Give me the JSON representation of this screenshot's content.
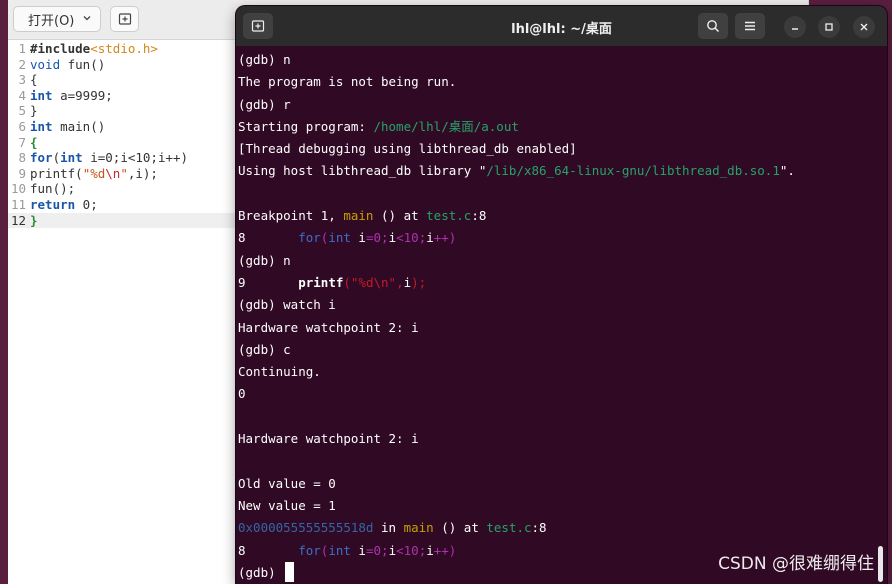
{
  "editor": {
    "open_button_label": "打开(O)",
    "lines": [
      {
        "num": "1"
      },
      {
        "num": "2"
      },
      {
        "num": "3"
      },
      {
        "num": "4"
      },
      {
        "num": "5"
      },
      {
        "num": "6"
      },
      {
        "num": "7"
      },
      {
        "num": "8"
      },
      {
        "num": "9"
      },
      {
        "num": "10"
      },
      {
        "num": "11"
      },
      {
        "num": "12"
      }
    ]
  },
  "terminal": {
    "title": "lhl@lhl: ~/桌面",
    "lines": [
      "(gdb) n",
      "The program is not being run.",
      "(gdb) r",
      "Starting program: ",
      "/home/lhl/桌面/a.out",
      "[Thread debugging using libthread_db enabled]",
      "Using host libthread_db library \"",
      "/lib/x86_64-linux-gnu/libthread_db.so.1",
      "\".",
      "Breakpoint 1, ",
      "main",
      " () at ",
      "test.c",
      ":8",
      "8       ",
      "(gdb) n",
      "9       ",
      "(gdb) watch i",
      "Hardware watchpoint 2: i",
      "(gdb) c",
      "Continuing.",
      "0",
      "Hardware watchpoint 2: i",
      "Old value = 0",
      "New value = 1",
      "0x000055555555518d",
      " in ",
      "main",
      " () at ",
      "test.c",
      ":8",
      "8       ",
      "(gdb) "
    ]
  },
  "watermark": "CSDN @很难绷得住"
}
